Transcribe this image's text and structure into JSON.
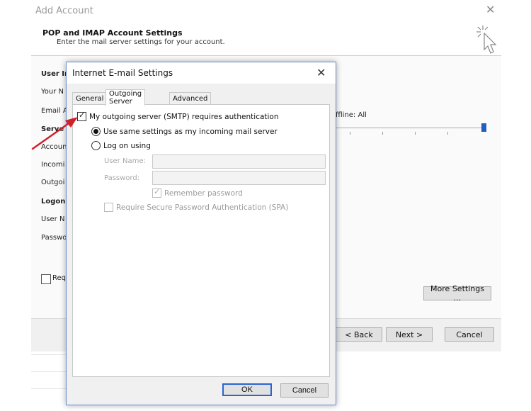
{
  "background_window": {
    "title": "Add Account",
    "heading": "POP and IMAP Account Settings",
    "subheading": "Enter the mail server settings for your account.",
    "left_labels": {
      "user_info": "User In",
      "your_name": "Your N",
      "email": "Email A",
      "server_info": "Serve",
      "account_type": "Accoun",
      "incoming": "Incomi",
      "outgoing": "Outgoi",
      "logon_info": "Logon",
      "user_name": "User N",
      "password": "Passwo",
      "require": "Req"
    },
    "offline_label": "ffline:  All",
    "more_settings_label": "More Settings ...",
    "back_label": "< Back",
    "next_label": "Next >",
    "cancel_label": "Cancel"
  },
  "dialog": {
    "title": "Internet E-mail Settings",
    "tabs": [
      {
        "label": "General",
        "active": false
      },
      {
        "label": "Outgoing Server",
        "active": true
      },
      {
        "label": "Advanced",
        "active": false
      }
    ],
    "smtp_auth": {
      "label": "My outgoing server (SMTP) requires authentication",
      "checked": true
    },
    "use_same": {
      "label": "Use same settings as my incoming mail server",
      "selected": true
    },
    "log_on_using": {
      "label": "Log on using",
      "selected": false
    },
    "user_name_label": "User Name:",
    "password_label": "Password:",
    "user_name_value": "",
    "password_value": "",
    "remember_password": {
      "label": "Remember password",
      "checked": true,
      "enabled": false
    },
    "require_spa": {
      "label": "Require Secure Password Authentication (SPA)",
      "checked": false,
      "enabled": false
    },
    "ok_label": "OK",
    "cancel_label": "Cancel"
  },
  "check_glyph": "✓",
  "colors": {
    "accent": "#2b64d0",
    "annotation_arrow": "#d0202a",
    "slider_thumb": "#1f5fbf"
  }
}
